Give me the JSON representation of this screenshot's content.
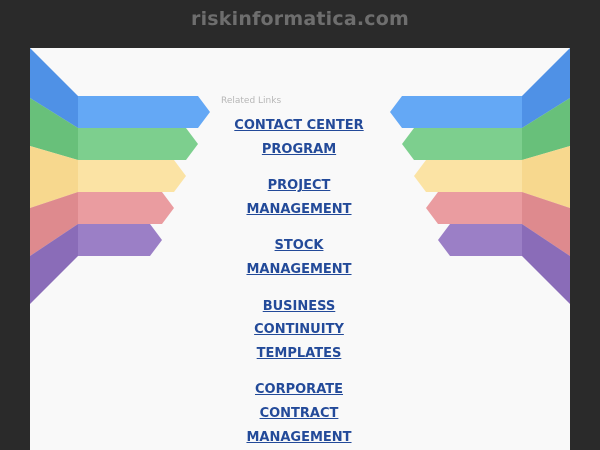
{
  "header": {
    "site_title": "riskinformatica.com"
  },
  "related": {
    "title": "Related Links",
    "links": [
      {
        "line1": "CONTACT CENTER",
        "line2": "PROGRAM"
      },
      {
        "line1": "PROJECT",
        "line2": "MANAGEMENT"
      },
      {
        "line1": "STOCK",
        "line2": "MANAGEMENT"
      },
      {
        "line1": "BUSINESS",
        "line2": "CONTINUITY",
        "line3": "TEMPLATES"
      },
      {
        "line1": "CORPORATE",
        "line2": "CONTRACT",
        "line3": "MANAGEMENT"
      }
    ]
  },
  "colors": {
    "background": "#2a2a2a",
    "panel": "#f9f9f9",
    "link": "#234a99",
    "ribbon_blue": "#64a8f5",
    "ribbon_green": "#7dcf8e",
    "ribbon_yellow": "#fbe3a4",
    "ribbon_red": "#ea9ca0",
    "ribbon_purple": "#9b7fc6"
  }
}
